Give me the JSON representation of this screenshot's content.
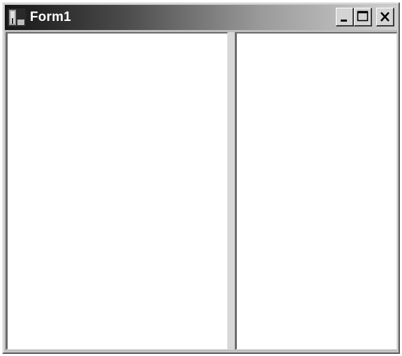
{
  "window": {
    "title": "Form1",
    "icon": "form-app-icon",
    "controls": {
      "minimize_icon": "minimize-icon",
      "maximize_icon": "maximize-icon",
      "close_icon": "close-icon"
    }
  },
  "colors": {
    "titlebar_start": "#161616",
    "titlebar_end": "#d0d0d0",
    "title_text": "#ffffff",
    "panel_background": "#ffffff",
    "splitter": "#d8d8d8"
  }
}
